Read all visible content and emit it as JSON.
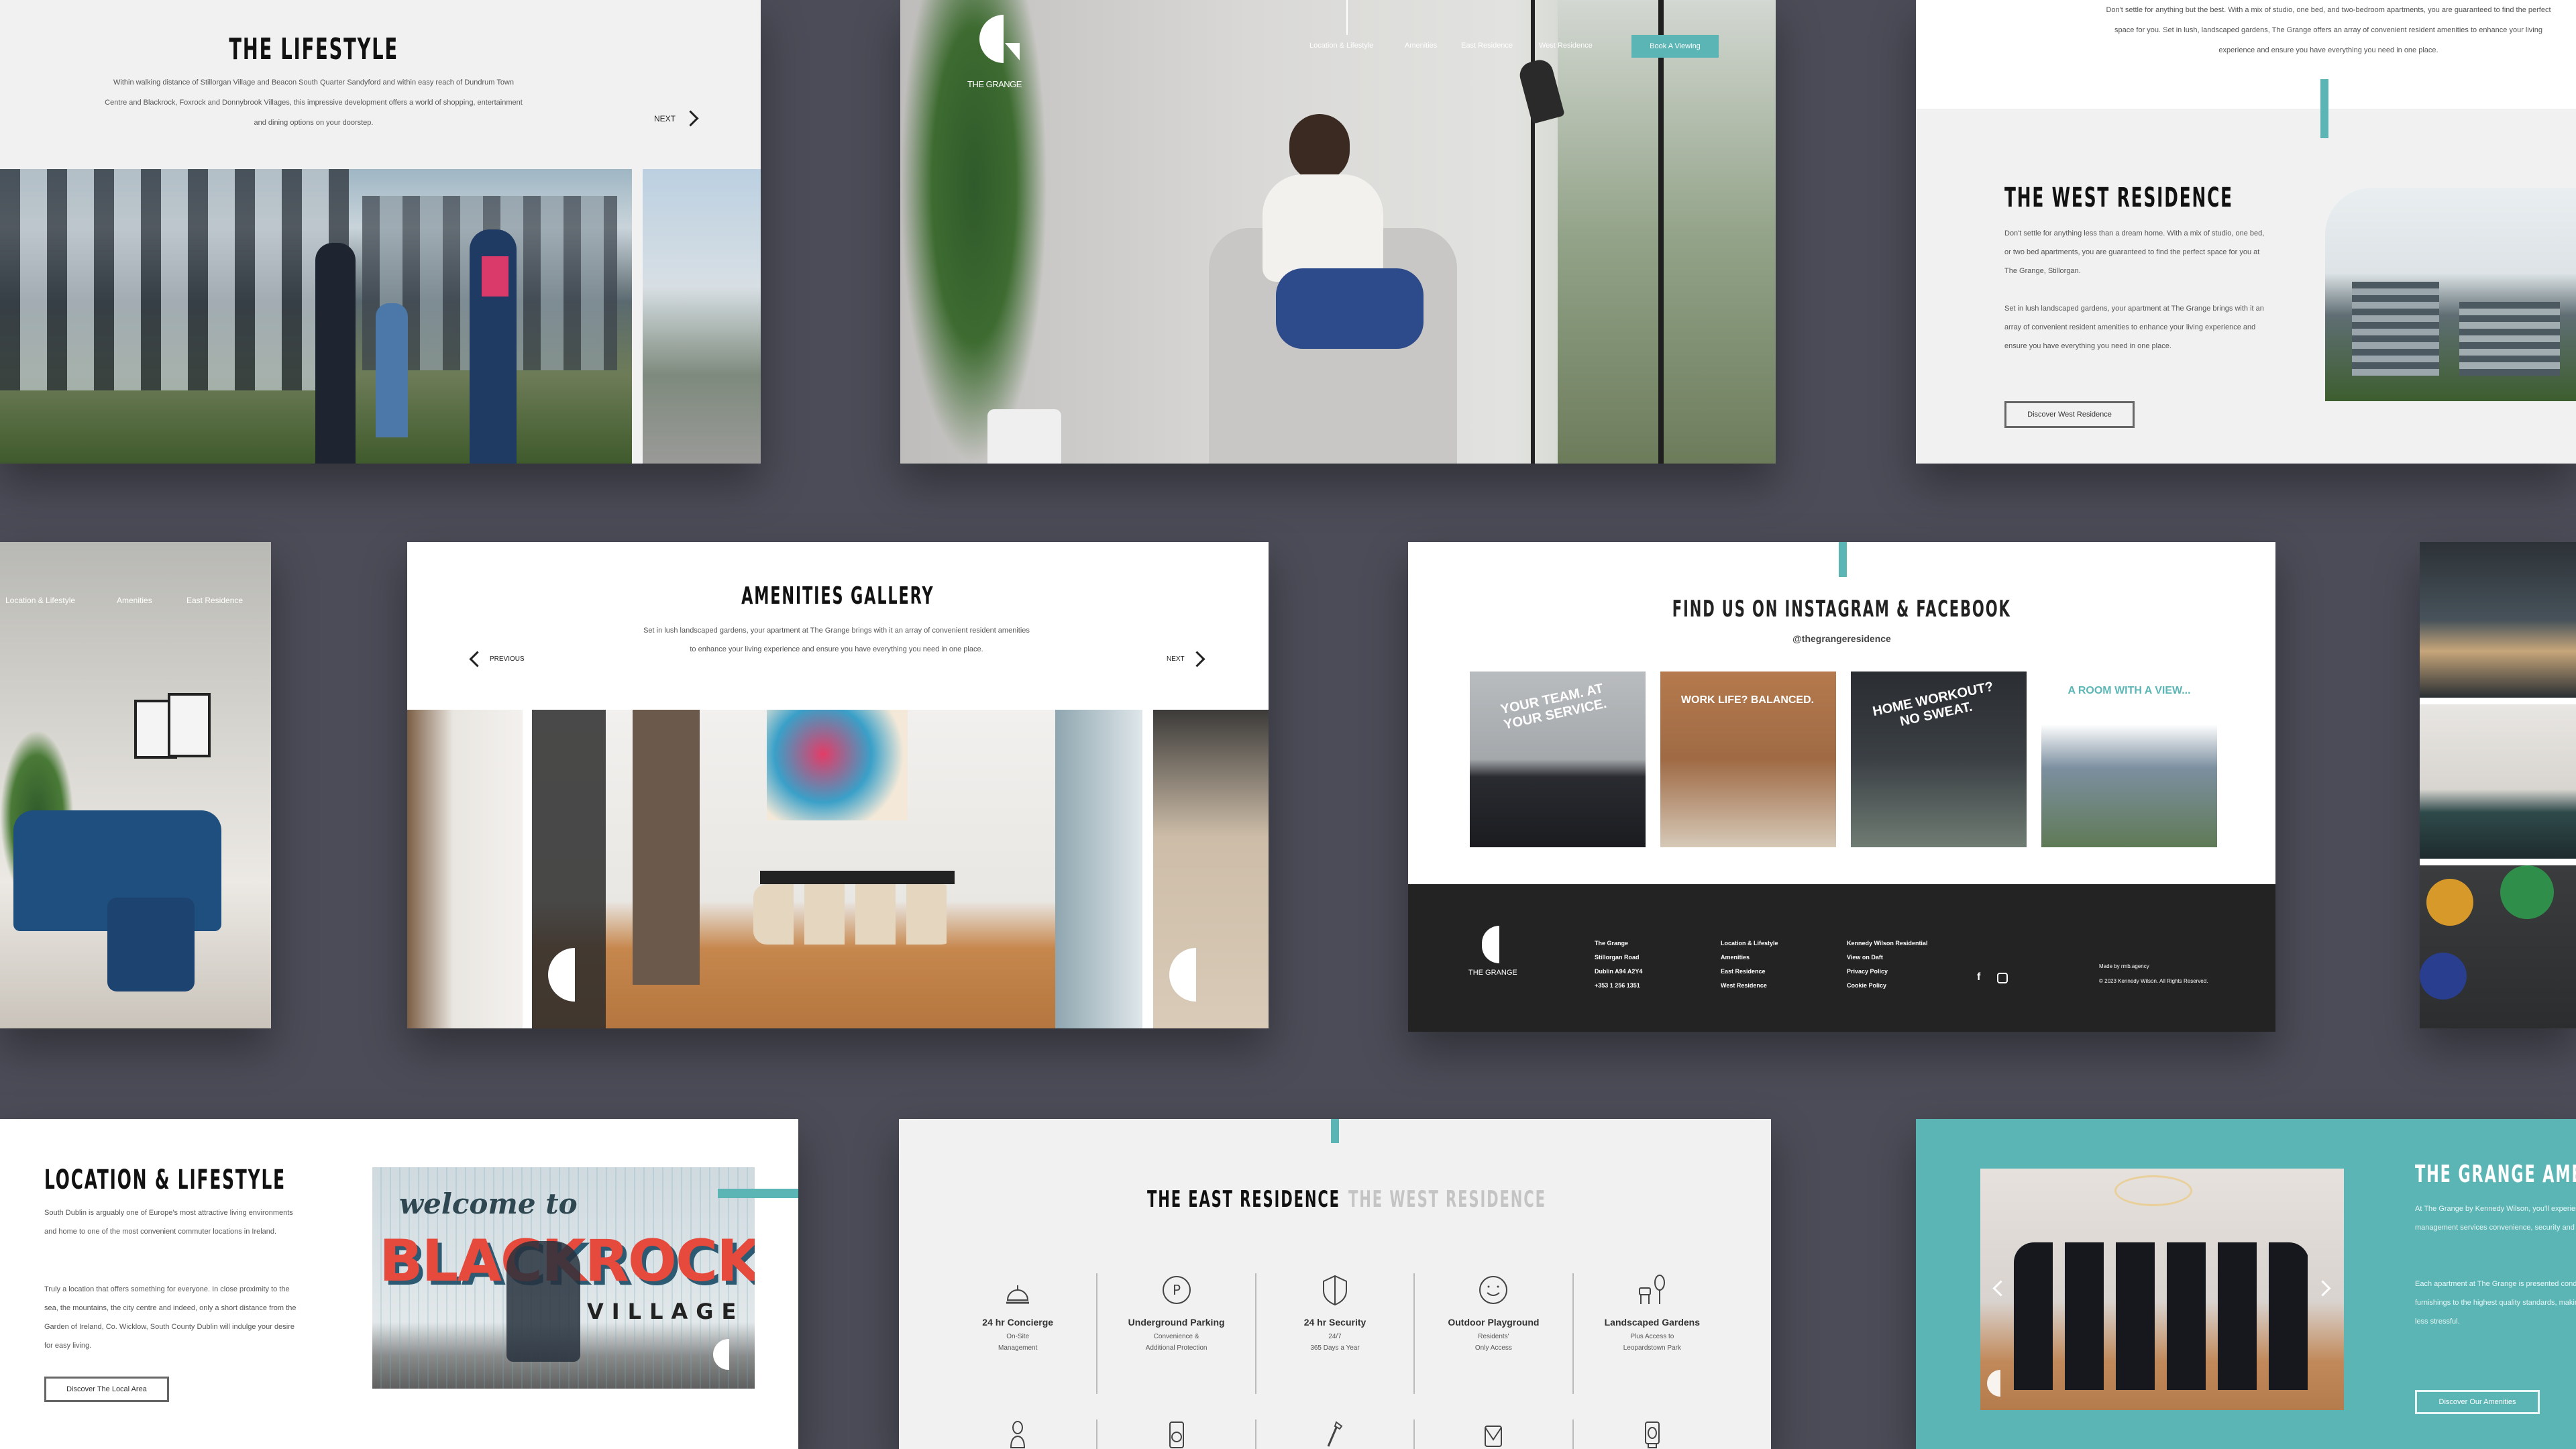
{
  "colors": {
    "background": "#4b4c57",
    "accent_teal": "#5bb5b5",
    "footer_dark": "#232323"
  },
  "lifestyle": {
    "title": "THE LIFESTYLE",
    "body": "Within walking distance of Stillorgan Village and Beacon South Quarter Sandyford and within easy reach of Dundrum Town Centre and Blackrock, Foxrock and Donnybrook Villages, this impressive development offers a world of shopping, entertainment and dining options on your doorstep.",
    "next_label": "NEXT"
  },
  "hero": {
    "logo_text": "THE GRANGE",
    "nav": [
      "Location & Lifestyle",
      "Amenities",
      "East Residence",
      "West Residence"
    ],
    "cta": "Book A Viewing"
  },
  "west_residence": {
    "intro": "Don't settle for anything but the best. With a mix of studio, one bed, and two-bedroom apartments, you are guaranteed to find the perfect space for you. Set in lush, landscaped gardens, The Grange offers an array of convenient resident amenities to enhance your living experience and ensure you have everything you need in one place.",
    "title": "THE WEST RESIDENCE",
    "para1": "Don't settle for anything less than a dream home. With a mix of studio, one bed, or two bed apartments, you are guaranteed to find the perfect space for you at The Grange, Stillorgan.",
    "para2": "Set in lush landscaped gardens, your apartment at The Grange brings with it an array of convenient resident amenities to enhance your living experience and ensure you have everything you need in one place.",
    "button": "Discover West Residence"
  },
  "living_room": {
    "nav": [
      "Location & Lifestyle",
      "Amenities",
      "East Residence"
    ]
  },
  "gallery": {
    "title": "AMENITIES GALLERY",
    "body": "Set in lush landscaped gardens, your apartment at The Grange brings with it an array of convenient resident amenities to enhance your living experience and ensure you have everything you need in one place.",
    "prev_label": "PREVIOUS",
    "next_label": "NEXT"
  },
  "social": {
    "title": "FIND US ON INSTAGRAM & FACEBOOK",
    "handle": "@thegrangeresidence",
    "posts": [
      {
        "caption": "YOUR TEAM. AT YOUR SERVICE."
      },
      {
        "caption": "WORK LIFE? BALANCED."
      },
      {
        "caption": "HOME WORKOUT? NO SWEAT."
      },
      {
        "caption": "A ROOM WITH A VIEW..."
      }
    ],
    "footer": {
      "logo_text": "THE GRANGE",
      "address": [
        "The Grange",
        "Stillorgan Road",
        "Dublin A94 A2Y4",
        "+353 1 256 1351"
      ],
      "links1": [
        "Location & Lifestyle",
        "Amenities",
        "East Residence",
        "West Residence"
      ],
      "links2": [
        "Kennedy Wilson Residential",
        "View on Daft",
        "Privacy Policy",
        "Cookie Policy"
      ],
      "made_by": "Made by rmb.agency",
      "copyright": "© 2023 Kennedy Wilson. All Rights Reserved."
    }
  },
  "location": {
    "title": "LOCATION & LIFESTYLE",
    "para1": "South Dublin is arguably one of Europe's most attractive living environments and home to one of the most convenient commuter locations in Ireland.",
    "para2": "Truly a location that offers something for everyone. In close proximity to the sea, the mountains, the city centre and indeed, only a short distance from the Garden of Ireland, Co. Wicklow, South County Dublin will indulge your desire for easy living.",
    "button": "Discover The Local Area",
    "mural_script": "welcome to",
    "mural_main": "BLACKROCK",
    "mural_sub": "VILLAGE"
  },
  "east_residence": {
    "tab_active": "THE EAST RESIDENCE",
    "tab_inactive": "THE WEST RESIDENCE",
    "features": [
      {
        "icon": "bell-icon",
        "title": "24 hr Concierge",
        "line1": "On-Site",
        "line2": "Management"
      },
      {
        "icon": "parking-icon",
        "title": "Underground Parking",
        "line1": "Convenience &",
        "line2": "Additional Protection"
      },
      {
        "icon": "shield-icon",
        "title": "24 hr Security",
        "line1": "24/7",
        "line2": "365 Days a Year"
      },
      {
        "icon": "smiley-icon",
        "title": "Outdoor Playground",
        "line1": "Residents'",
        "line2": "Only Access"
      },
      {
        "icon": "garden-icon",
        "title": "Landscaped Gardens",
        "line1": "Plus Access to",
        "line2": "Leopardstown Park"
      }
    ],
    "bottom_icons": [
      "person-icon",
      "washing-machine-icon",
      "hammer-icon",
      "mail-icon",
      "speaker-icon"
    ]
  },
  "grange_amenities": {
    "title": "THE GRANGE AMENITIES",
    "para1": "At The Grange by Kennedy Wilson, you'll experience amenities and on-site management services convenience, security and sense of comfort",
    "para2": "Each apartment at The Grange is presented condition with custom designed furnishings to the highest quality standards, making move easier, faster, and less stressful.",
    "button": "Discover Our Amenities"
  }
}
